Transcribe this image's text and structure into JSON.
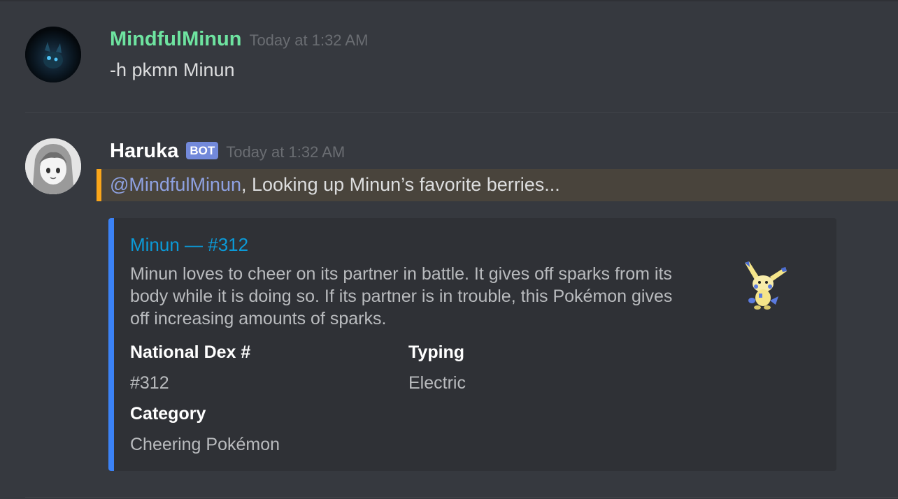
{
  "messages": [
    {
      "author": "MindfulMinun",
      "timestamp": "Today at 1:32 AM",
      "text": "-h pkmn Minun",
      "avatar_icon": "user-avatar",
      "name_color": "#6ee3a0"
    },
    {
      "author": "Haruka",
      "bot_tag": "BOT",
      "timestamp": "Today at 1:32 AM",
      "mention": "@MindfulMinun",
      "text_after_mention": ", Looking up Minun’s favorite berries...",
      "avatar_icon": "bot-avatar",
      "highlight_color": "#faa61a"
    }
  ],
  "embed": {
    "title": "Minun — #312",
    "description": "Minun loves to cheer on its partner in battle. It gives off sparks from its body while it is doing so. If its partner is in trouble, this Pokémon gives off increasing amounts of sparks.",
    "thumbnail_icon": "minun-sprite",
    "accent_color": "#3b82f6",
    "fields": [
      {
        "name": "National Dex #",
        "value": "#312"
      },
      {
        "name": "Typing",
        "value": "Electric"
      },
      {
        "name": "Category",
        "value": "Cheering Pokémon"
      }
    ]
  },
  "colors": {
    "background": "#36393f",
    "embed_background": "#2f3136",
    "link": "#0b9ad8",
    "mention": "#8ea1e1",
    "bot_tag": "#7289da"
  }
}
